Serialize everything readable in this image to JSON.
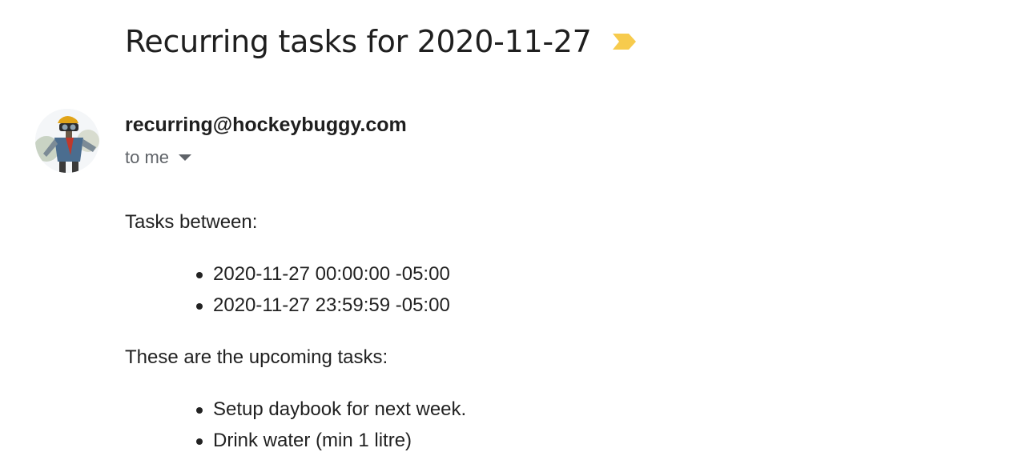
{
  "email": {
    "subject": "Recurring tasks for 2020-11-27",
    "importance_marker_color": "#f7cb4d",
    "sender": "recurring@hockeybuggy.com",
    "recipient_text": "to me",
    "avatar_icon": "robot-avatar"
  },
  "body": {
    "intro": "Tasks between:",
    "range": [
      "2020-11-27 00:00:00 -05:00",
      "2020-11-27 23:59:59 -05:00"
    ],
    "upcoming_intro": "These are the upcoming tasks:",
    "tasks": [
      "Setup daybook for next week.",
      "Drink water (min 1 litre)"
    ]
  }
}
